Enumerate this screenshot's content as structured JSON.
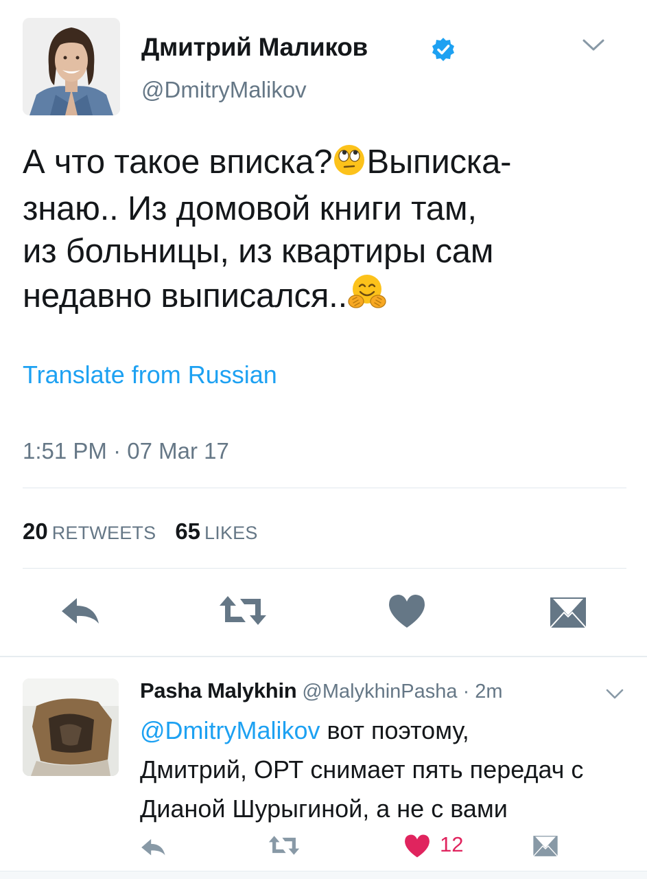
{
  "tweet": {
    "author_name": "Дмитрий Маликов",
    "author_handle": "@DmitryMalikov",
    "text_lines": [
      "А что такое вписка?",
      "Выписка-",
      "знаю.. Из домовой книги там,",
      "из больницы, из квартиры сам",
      "недавно выписался.."
    ],
    "translate_label": "Translate from Russian",
    "timestamp": "1:51 PM · 07 Mar 17",
    "retweets_count": "20",
    "retweets_label": "RETWEETS",
    "likes_count": "65",
    "likes_label": "LIKES"
  },
  "reply": {
    "author_name": "Pasha Malykhin",
    "author_handle": "@MalykhinPasha",
    "separator": " · ",
    "time": "2m",
    "mention": "@DmitryMalikov",
    "text_first": " вот поэтому,",
    "text_lines": [
      "Дмитрий, ОРТ снимает пять передач с",
      "Дианой Шурыгиной, а не с вами"
    ],
    "like_count": "12"
  },
  "icons": {
    "verified": "verified-badge-icon",
    "caret": "chevron-down-icon",
    "reply": "reply-icon",
    "retweet": "retweet-icon",
    "like": "heart-icon",
    "dm": "envelope-icon",
    "emoji_1": "face-with-rolling-eyes-emoji",
    "emoji_2": "hugging-face-emoji"
  },
  "colors": {
    "link": "#1da1f2",
    "secondary_text": "#657786",
    "action_gray": "#657786",
    "liked_red": "#e0245e",
    "divider": "#e1e8ed"
  }
}
